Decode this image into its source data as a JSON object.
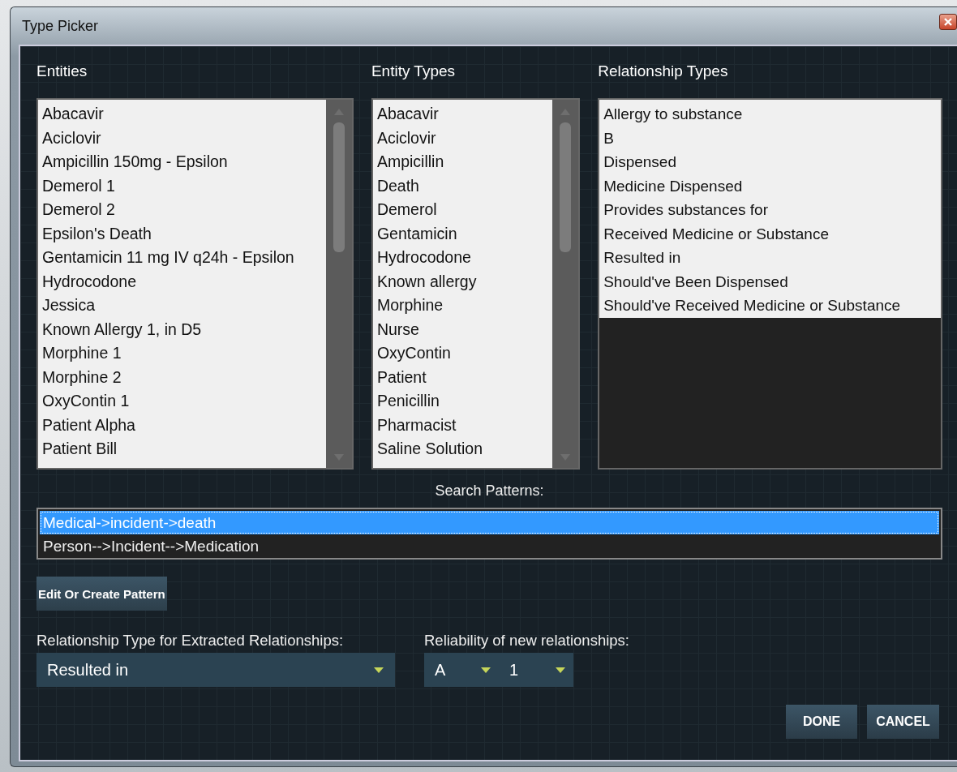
{
  "window": {
    "title": "Type Picker"
  },
  "entities": {
    "label": "Entities",
    "items": [
      "Abacavir",
      "Aciclovir",
      "Ampicillin 150mg - Epsilon",
      "Demerol 1",
      "Demerol 2",
      "Epsilon's Death",
      "Gentamicin 11 mg IV q24h - Epsilon",
      "Hydrocodone",
      "Jessica",
      "Known Allergy 1, in D5",
      "Morphine 1",
      "Morphine 2",
      "OxyContin 1",
      "Patient Alpha",
      "Patient Bill"
    ]
  },
  "entity_types": {
    "label": "Entity Types",
    "items": [
      "Abacavir",
      "Aciclovir",
      "Ampicillin",
      "Death",
      "Demerol",
      "Gentamicin",
      "Hydrocodone",
      "Known allergy",
      "Morphine",
      "Nurse",
      "OxyContin",
      "Patient",
      "Penicillin",
      "Pharmacist",
      "Saline Solution"
    ]
  },
  "relationship_types": {
    "label": "Relationship Types",
    "items": [
      "Allergy to substance",
      "B",
      "Dispensed",
      "Medicine Dispensed",
      "Provides substances for",
      "Received Medicine or Substance",
      "Resulted in",
      "Should've Been Dispensed",
      "Should've Received Medicine or Substance"
    ]
  },
  "search_patterns": {
    "label": "Search Patterns:",
    "items": [
      {
        "text": "Medical->incident->death",
        "selected": true
      },
      {
        "text": "Person-->Incident-->Medication",
        "selected": false
      }
    ]
  },
  "edit_button": "Edit Or Create Pattern",
  "relationship_type": {
    "label": "Relationship Type for Extracted Relationships:",
    "value": "Resulted in"
  },
  "reliability": {
    "label": "Reliability of new relationships:",
    "source": "A",
    "information": "1"
  },
  "buttons": [
    "DONE",
    "CANCEL"
  ]
}
